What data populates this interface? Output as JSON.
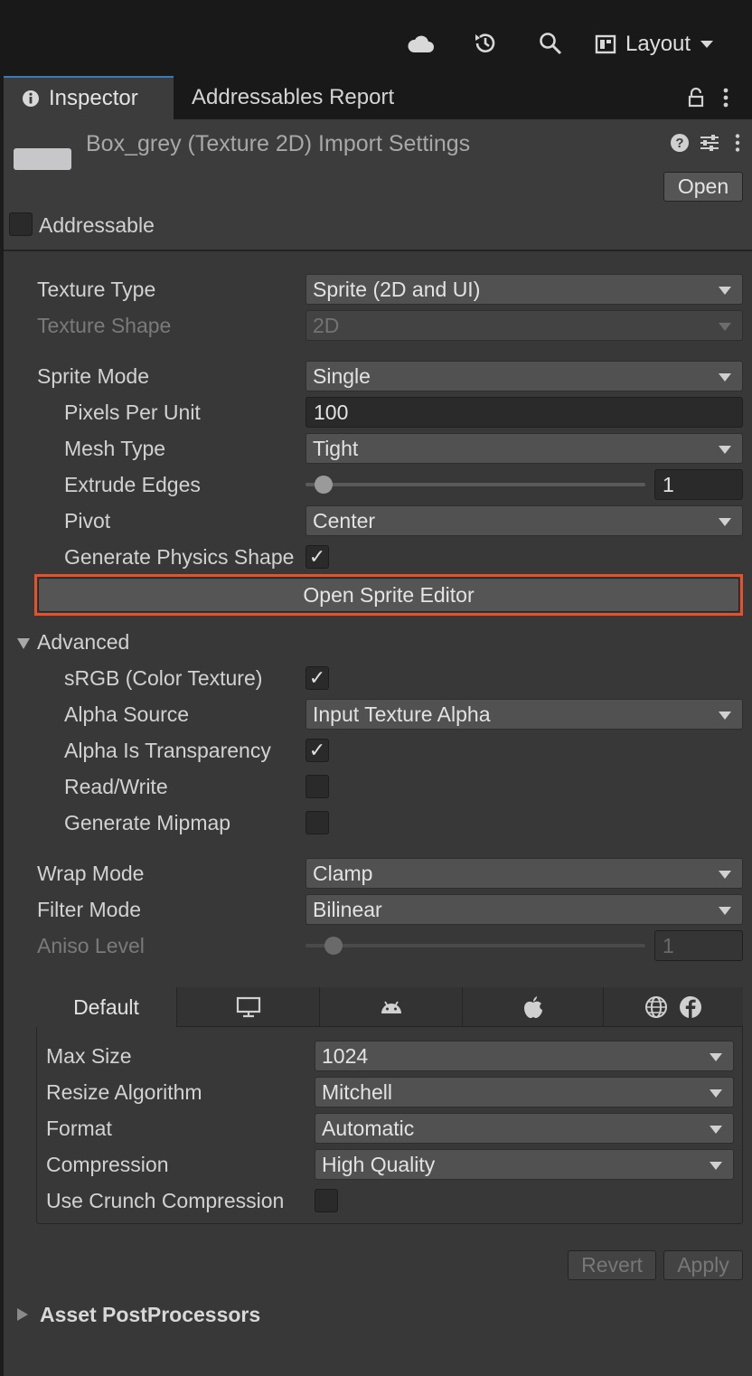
{
  "toolbar": {
    "icons": [
      "cloud-icon",
      "history-icon",
      "search-icon"
    ],
    "layout_label": "Layout"
  },
  "tabs": {
    "inspector": "Inspector",
    "addressables_report": "Addressables Report"
  },
  "header": {
    "title": "Box_grey (Texture 2D) Import Settings",
    "open_label": "Open",
    "addressable_label": "Addressable",
    "addressable_checked": false
  },
  "settings": {
    "texture_type": {
      "label": "Texture Type",
      "value": "Sprite (2D and UI)"
    },
    "texture_shape": {
      "label": "Texture Shape",
      "value": "2D"
    },
    "sprite_mode": {
      "label": "Sprite Mode",
      "value": "Single"
    },
    "pixels_per_unit": {
      "label": "Pixels Per Unit",
      "value": "100"
    },
    "mesh_type": {
      "label": "Mesh Type",
      "value": "Tight"
    },
    "extrude_edges": {
      "label": "Extrude Edges",
      "value": "1",
      "slider_fraction": 0.05
    },
    "pivot": {
      "label": "Pivot",
      "value": "Center"
    },
    "generate_physics_shape": {
      "label": "Generate Physics Shape",
      "checked": true
    },
    "open_sprite_editor": "Open Sprite Editor"
  },
  "advanced": {
    "label": "Advanced",
    "srgb": {
      "label": "sRGB (Color Texture)",
      "checked": true
    },
    "alpha_source": {
      "label": "Alpha Source",
      "value": "Input Texture Alpha"
    },
    "alpha_is_transparency": {
      "label": "Alpha Is Transparency",
      "checked": true
    },
    "read_write": {
      "label": "Read/Write",
      "checked": false
    },
    "generate_mipmap": {
      "label": "Generate Mipmap",
      "checked": false
    }
  },
  "sampling": {
    "wrap_mode": {
      "label": "Wrap Mode",
      "value": "Clamp"
    },
    "filter_mode": {
      "label": "Filter Mode",
      "value": "Bilinear"
    },
    "aniso_level": {
      "label": "Aniso Level",
      "value": "1",
      "slider_fraction": 0.1
    }
  },
  "platform": {
    "tabs": [
      "Default",
      "desktop-icon",
      "android-icon",
      "apple-icon",
      "web-facebook-icon"
    ],
    "default_label": "Default",
    "max_size": {
      "label": "Max Size",
      "value": "1024"
    },
    "resize_algorithm": {
      "label": "Resize Algorithm",
      "value": "Mitchell"
    },
    "format": {
      "label": "Format",
      "value": "Automatic"
    },
    "compression": {
      "label": "Compression",
      "value": "High Quality"
    },
    "use_crunch": {
      "label": "Use Crunch Compression",
      "checked": false
    }
  },
  "footer": {
    "revert_label": "Revert",
    "apply_label": "Apply",
    "postprocessors_label": "Asset PostProcessors"
  },
  "colors": {
    "highlight_border": "#e8502a",
    "tab_accent": "#3a79bb"
  }
}
